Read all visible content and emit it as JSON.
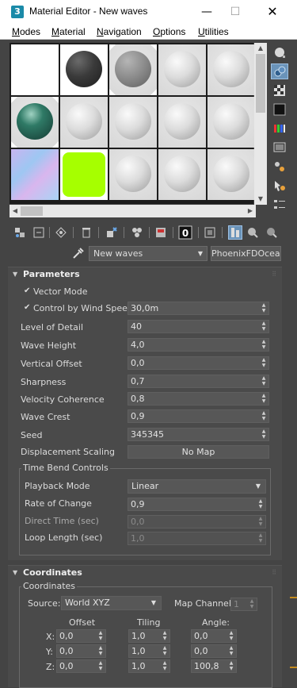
{
  "window": {
    "app_icon_label": "3",
    "title": "Material Editor - New waves",
    "minimize_label": "—",
    "maximize_label": "☐",
    "close_label": "✕"
  },
  "menu": [
    "Modes",
    "Material",
    "Navigation",
    "Options",
    "Utilities"
  ],
  "material": {
    "name": "New waves",
    "type": "PhoenixFDOceanTex"
  },
  "parameters": {
    "title": "Parameters",
    "vector_mode": {
      "label": "Vector Mode",
      "checked": true
    },
    "control_by_wind_speed": {
      "label": "Control by Wind Speed",
      "checked": true,
      "value": "30,0m"
    },
    "level_of_detail": {
      "label": "Level of Detail",
      "value": "40"
    },
    "wave_height": {
      "label": "Wave Height",
      "value": "4,0"
    },
    "vertical_offset": {
      "label": "Vertical Offset",
      "value": "0,0"
    },
    "sharpness": {
      "label": "Sharpness",
      "value": "0,7"
    },
    "velocity_coherence": {
      "label": "Velocity Coherence",
      "value": "0,8"
    },
    "wave_crest": {
      "label": "Wave Crest",
      "value": "0,9"
    },
    "seed": {
      "label": "Seed",
      "value": "345345"
    },
    "displacement_scaling": {
      "label": "Displacement Scaling",
      "button": "No Map"
    },
    "time_bend": {
      "title": "Time Bend Controls",
      "playback_mode": {
        "label": "Playback Mode",
        "value": "Linear"
      },
      "rate_of_change": {
        "label": "Rate of Change",
        "value": "0,9"
      },
      "direct_time": {
        "label": "Direct Time (sec)",
        "value": "0,0"
      },
      "loop_length": {
        "label": "Loop Length (sec)",
        "value": "1,0"
      }
    }
  },
  "coordinates": {
    "title": "Coordinates",
    "group_title": "Coordinates",
    "source_label": "Source:",
    "source_value": "World XYZ",
    "map_channel_label": "Map Channel:",
    "map_channel_value": "1",
    "col_offset": "Offset",
    "col_tiling": "Tiling",
    "col_angle": "Angle:",
    "rows": [
      {
        "axis": "X:",
        "offset": "0,0",
        "tiling": "1,0",
        "angle": "0,0"
      },
      {
        "axis": "Y:",
        "offset": "0,0",
        "tiling": "1,0",
        "angle": "0,0"
      },
      {
        "axis": "Z:",
        "offset": "0,0",
        "tiling": "1,0",
        "angle": "100,8"
      }
    ]
  },
  "colors": {
    "panel_bg": "#444444",
    "accent_blue": "#6a93b9",
    "swatch_green": "#a6ff00",
    "swatch_teal": "#2e6b5d"
  }
}
